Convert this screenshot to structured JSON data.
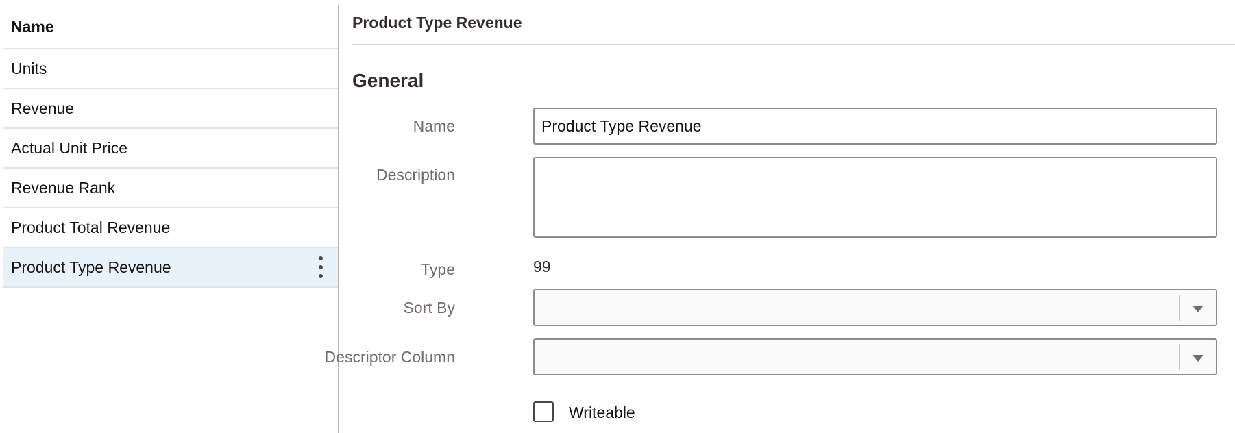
{
  "list": {
    "header": "Name",
    "items": [
      {
        "label": "Units"
      },
      {
        "label": "Revenue"
      },
      {
        "label": "Actual Unit Price"
      },
      {
        "label": "Revenue Rank"
      },
      {
        "label": "Product Total Revenue"
      },
      {
        "label": "Product Type Revenue",
        "selected": true
      }
    ],
    "menu_icon": "kebab-menu-icon"
  },
  "detail": {
    "title": "Product Type Revenue",
    "section_title": "General",
    "name": {
      "label": "Name",
      "value": "Product Type Revenue"
    },
    "description": {
      "label": "Description",
      "value": ""
    },
    "type": {
      "label": "Type",
      "value": "99"
    },
    "sort_by": {
      "label": "Sort By",
      "value": ""
    },
    "descriptor_column": {
      "label": "Descriptor Column",
      "value": ""
    },
    "writeable": {
      "label": "Writeable",
      "checked": false
    }
  },
  "colors": {
    "selected_row": "#e8f2fa",
    "border": "#8e8b88",
    "label_text": "#6f6b67"
  }
}
